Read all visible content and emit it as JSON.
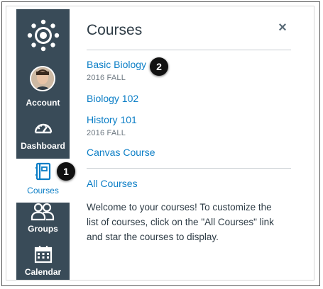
{
  "nav": {
    "account_label": "Account",
    "dashboard_label": "Dashboard",
    "courses_label": "Courses",
    "groups_label": "Groups",
    "calendar_label": "Calendar"
  },
  "tray": {
    "title": "Courses",
    "close_icon": "close-icon",
    "courses": [
      {
        "name": "Basic Biology",
        "term": "2016 FALL"
      },
      {
        "name": "Biology 102",
        "term": ""
      },
      {
        "name": "History 101",
        "term": "2016 FALL"
      },
      {
        "name": "Canvas Course",
        "term": ""
      }
    ],
    "all_courses_label": "All Courses",
    "description": "Welcome to your courses! To customize the list of courses, click on the \"All Courses\" link and star the courses to display."
  },
  "callouts": [
    "1",
    "2"
  ],
  "colors": {
    "nav_bg": "#394b58",
    "link": "#0b7ec6",
    "text": "#2d3b45"
  }
}
